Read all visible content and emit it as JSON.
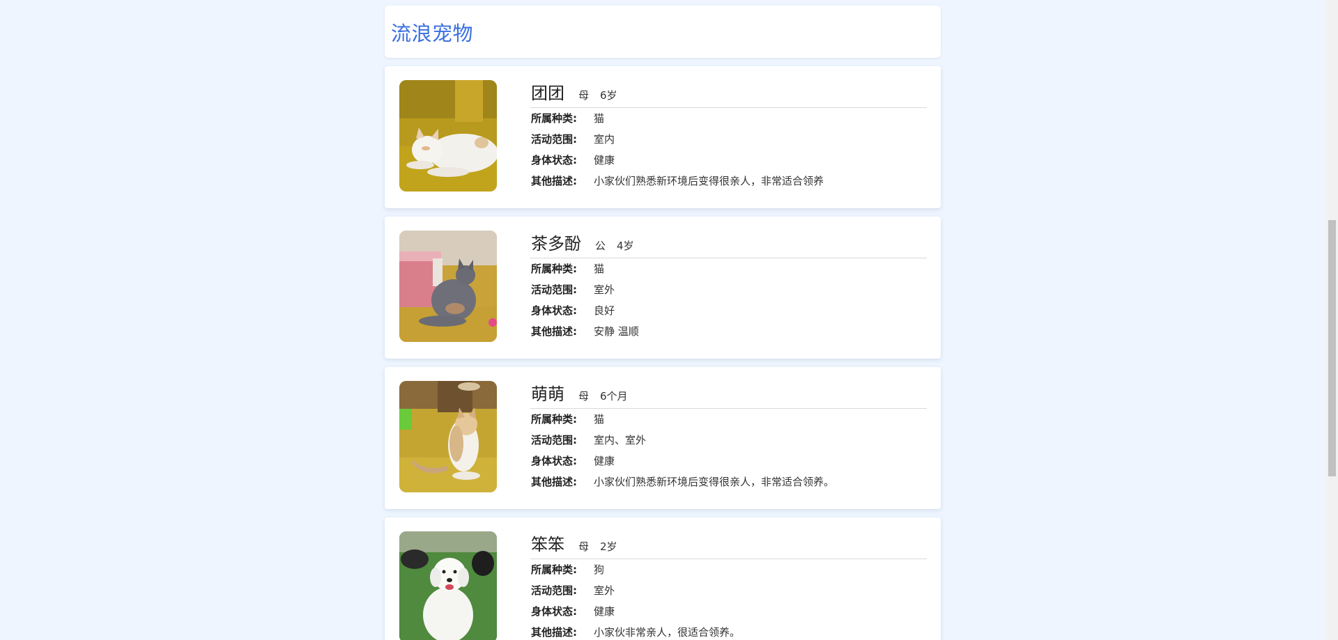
{
  "header": {
    "title": "流浪宠物"
  },
  "labels": {
    "category": "所属种类:",
    "range": "活动范围:",
    "health": "身体状态:",
    "desc": "其他描述:"
  },
  "pets": [
    {
      "name": "团团",
      "sex": "母",
      "age": "6岁",
      "category": "猫",
      "range": "室内",
      "health": "健康",
      "desc": "小家伙们熟悉新环境后变得很亲人，非常适合领养",
      "photo": "cat-photo-white-orange"
    },
    {
      "name": "茶多酚",
      "sex": "公",
      "age": "4岁",
      "category": "猫",
      "range": "室外",
      "health": "良好",
      "desc": "安静 温顺",
      "photo": "cat-photo-gray"
    },
    {
      "name": "萌萌",
      "sex": "母",
      "age": "6个月",
      "category": "猫",
      "range": "室内、室外",
      "health": "健康",
      "desc": "小家伙们熟悉新环境后变得很亲人，非常适合领养。",
      "photo": "cat-photo-tabby-white"
    },
    {
      "name": "笨笨",
      "sex": "母",
      "age": "2岁",
      "category": "狗",
      "range": "室外",
      "health": "健康",
      "desc": "小家伙非常亲人，很适合领养。",
      "photo": "dog-photo-white"
    }
  ]
}
